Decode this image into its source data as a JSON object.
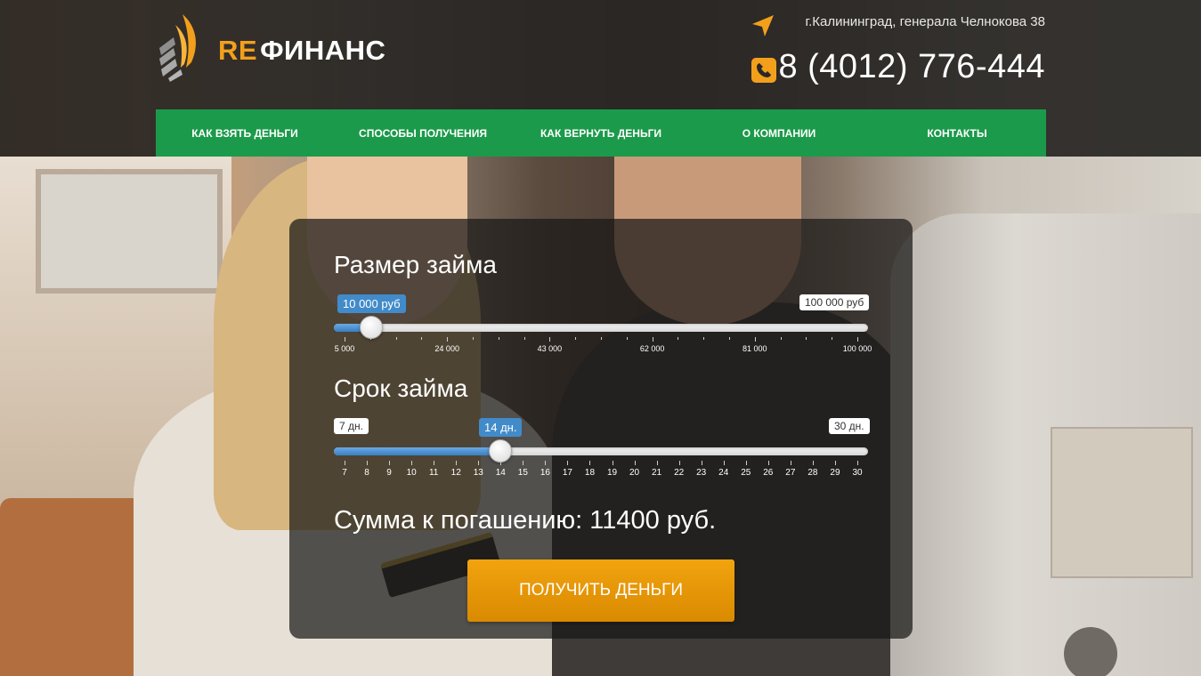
{
  "brand": {
    "prefix": "RE",
    "name": "ФИНАНС",
    "accent": "#f2a01c"
  },
  "header": {
    "address": "г.Калининград, генерала Челнокова 38",
    "phone": "8 (4012) 776-444",
    "icons": {
      "address": "location-arrow-icon",
      "phone": "phone-icon"
    }
  },
  "menu": {
    "color": "#1c9a4b",
    "items": [
      {
        "label": "КАК ВЗЯТЬ ДЕНЬГИ"
      },
      {
        "label": "СПОСОБЫ ПОЛУЧЕНИЯ"
      },
      {
        "label": "КАК ВЕРНУТЬ ДЕНЬГИ"
      },
      {
        "label": "О КОМПАНИИ"
      },
      {
        "label": "КОНТАКТЫ"
      }
    ]
  },
  "calculator": {
    "amount": {
      "title": "Размер займа",
      "min": 5000,
      "max": 100000,
      "value": 10000,
      "value_label": "10 000 руб",
      "max_label": "100 000 руб",
      "ticks": [
        "5 000",
        "24 000",
        "43 000",
        "62 000",
        "81 000",
        "100 000"
      ]
    },
    "term": {
      "title": "Срок займа",
      "min": 7,
      "max": 30,
      "value": 14,
      "min_label": "7 дн.",
      "value_label": "14 дн.",
      "max_label": "30 дн.",
      "ticks": [
        "7",
        "8",
        "9",
        "10",
        "11",
        "12",
        "13",
        "14",
        "15",
        "16",
        "17",
        "18",
        "19",
        "20",
        "21",
        "22",
        "23",
        "24",
        "25",
        "26",
        "27",
        "28",
        "29",
        "30"
      ]
    },
    "sum_text": "Сумма к погашению: 11400 руб.",
    "button_label": "ПОЛУЧИТЬ ДЕНЬГИ",
    "button_color": "#f2a30f"
  }
}
